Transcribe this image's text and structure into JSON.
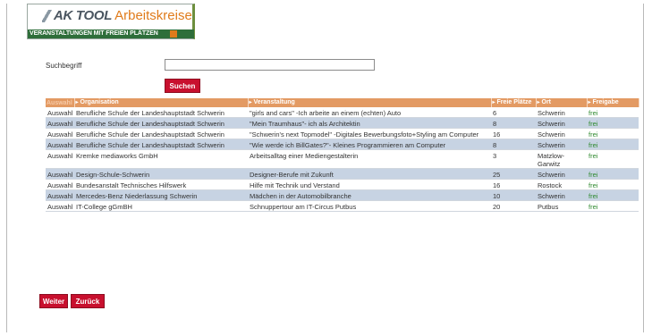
{
  "header": {
    "logo_brand": "AK TOOL",
    "logo_title": "Arbeitskreise",
    "subtitle": "VERANSTALTUNGEN MIT FREIEN PLÄTZEN",
    "colors": {
      "brand_green": "#2e6e3a",
      "accent_orange": "#e07b1b"
    }
  },
  "search": {
    "label": "Suchbegriff",
    "value": "",
    "placeholder": "",
    "button_label": "Suchen"
  },
  "table": {
    "columns": [
      "Auswahl",
      "Organisation",
      "Veranstaltung",
      "Freie Plätze",
      "Ort",
      "Freigabe"
    ],
    "rows": [
      {
        "select": "Auswahl",
        "org": "Berufliche Schule der Landeshauptstadt Schwerin",
        "event": "\"girls and cars\" -Ich arbeite an einem (echten) Auto",
        "free": "6",
        "place": "Schwerin",
        "release": "frei"
      },
      {
        "select": "Auswahl",
        "org": "Berufliche Schule der Landeshauptstadt Schwerin",
        "event": "\"Mein Traumhaus\"- ich als Architektin",
        "free": "8",
        "place": "Schwerin",
        "release": "frei"
      },
      {
        "select": "Auswahl",
        "org": "Berufliche Schule der Landeshauptstadt Schwerin",
        "event": "\"Schwerin's next Topmodel\" -Digitales Bewerbungsfoto+Styling am Computer",
        "free": "16",
        "place": "Schwerin",
        "release": "frei"
      },
      {
        "select": "Auswahl",
        "org": "Berufliche Schule der Landeshauptstadt Schwerin",
        "event": "\"Wie werde ich BillGates?\"- Kleines Programmieren am Computer",
        "free": "8",
        "place": "Schwerin",
        "release": "frei"
      },
      {
        "select": "Auswahl",
        "org": "Kremke mediaworks GmbH",
        "event": "Arbeitsalltag einer Mediengestalterin",
        "free": "3",
        "place": "Matzlow-Garwitz",
        "release": "frei"
      },
      {
        "select": "Auswahl",
        "org": "Design-Schule-Schwerin",
        "event": "Designer-Berufe mit Zukunft",
        "free": "25",
        "place": "Schwerin",
        "release": "frei"
      },
      {
        "select": "Auswahl",
        "org": "Bundesanstalt Technisches Hilfswerk",
        "event": "Hilfe mit Technik und Verstand",
        "free": "16",
        "place": "Rostock",
        "release": "frei"
      },
      {
        "select": "Auswahl",
        "org": "Mercedes-Benz Niederlassung Schwerin",
        "event": "Mädchen in der Automobilbranche",
        "free": "10",
        "place": "Schwerin",
        "release": "frei"
      },
      {
        "select": "Auswahl",
        "org": "IT-College gGmBH",
        "event": "Schnuppertour am IT-Circus Putbus",
        "free": "20",
        "place": "Putbus",
        "release": "frei"
      }
    ]
  },
  "footer": {
    "next_label": "Weiter",
    "back_label": "Zurück"
  }
}
